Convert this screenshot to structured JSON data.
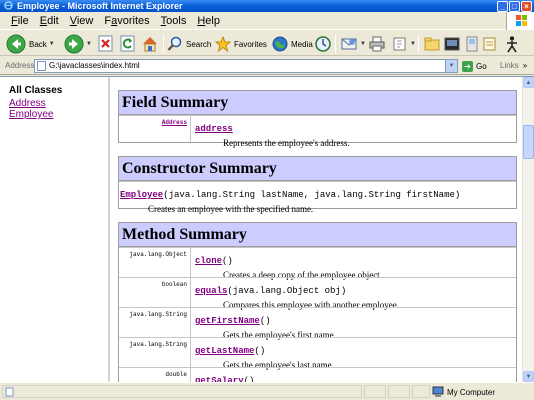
{
  "window": {
    "title": "Employee - Microsoft Internet Explorer"
  },
  "menu": [
    {
      "label": "File",
      "key": "F"
    },
    {
      "label": "Edit",
      "key": "E"
    },
    {
      "label": "View",
      "key": "V"
    },
    {
      "label": "Favorites",
      "key": "a"
    },
    {
      "label": "Tools",
      "key": "T"
    },
    {
      "label": "Help",
      "key": "H"
    }
  ],
  "toolbar": {
    "back_label": "Back",
    "search_label": "Search",
    "favorites_label": "Favorites",
    "media_label": "Media"
  },
  "address": {
    "label": "Address",
    "value": "G:\\javaclasses\\index.html",
    "go_label": "Go",
    "links_label": "Links"
  },
  "left_frame": {
    "heading": "All Classes",
    "links": [
      "Address",
      "Employee"
    ]
  },
  "field_summary": {
    "heading": "Field Summary",
    "rows": [
      {
        "type": "Address",
        "name": "address",
        "signature": "",
        "description": "Represents the employee's address."
      }
    ]
  },
  "constructor_summary": {
    "heading": "Constructor Summary",
    "rows": [
      {
        "name": "Employee",
        "signature": "(java.lang.String lastName, java.lang.String firstName)",
        "description": "Creates an employee with the specified name."
      }
    ]
  },
  "method_summary": {
    "heading": "Method Summary",
    "rows": [
      {
        "type": "java.lang.Object",
        "name": "clone",
        "signature": "()",
        "description": "Creates a deep copy of the employee object."
      },
      {
        "type": "boolean",
        "name": "equals",
        "signature": "(java.lang.Object obj)",
        "description": "Compares this employee with another employee."
      },
      {
        "type": "java.lang.String",
        "name": "getFirstName",
        "signature": "()",
        "description": "Gets the employee's first name."
      },
      {
        "type": "java.lang.String",
        "name": "getLastName",
        "signature": "()",
        "description": "Gets the employee's last name."
      },
      {
        "type": "double",
        "name": "getSalary",
        "signature": "()",
        "description": ""
      }
    ]
  },
  "status": {
    "zone": "My Computer"
  }
}
